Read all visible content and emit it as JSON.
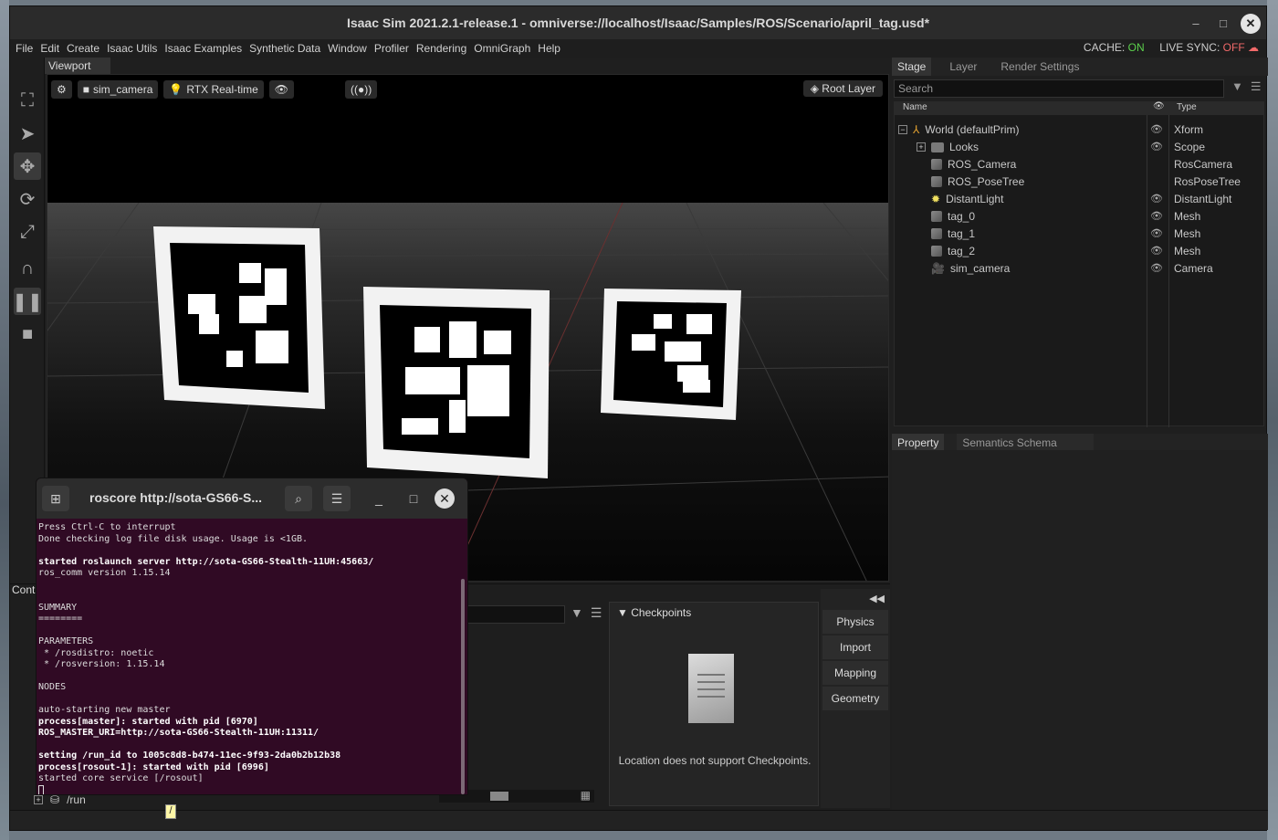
{
  "window": {
    "title": "Isaac Sim 2021.2.1-release.1 - omniverse://localhost/Isaac/Samples/ROS/Scenario/april_tag.usd*"
  },
  "menu": [
    "File",
    "Edit",
    "Create",
    "Isaac Utils",
    "Isaac Examples",
    "Synthetic Data",
    "Window",
    "Profiler",
    "Rendering",
    "OmniGraph",
    "Help"
  ],
  "status": {
    "cache_label": "CACHE:",
    "cache_value": "ON",
    "live_sync_label": "LIVE SYNC:",
    "live_sync_value": "OFF"
  },
  "viewport": {
    "tab": "Viewport",
    "camera": "sim_camera",
    "renderer": "RTX Real-time",
    "broadcast": "((●))",
    "root_layer": "Root Layer"
  },
  "stage": {
    "tabs": [
      "Stage",
      "Layer",
      "Render Settings"
    ],
    "search_placeholder": "Search",
    "col_name": "Name",
    "col_type": "Type",
    "rows": [
      {
        "name": "World (defaultPrim)",
        "type": "Xform",
        "visible": true
      },
      {
        "name": "Looks",
        "type": "Scope",
        "visible": true
      },
      {
        "name": "ROS_Camera",
        "type": "RosCamera",
        "visible": false
      },
      {
        "name": "ROS_PoseTree",
        "type": "RosPoseTree",
        "visible": false
      },
      {
        "name": "DistantLight",
        "type": "DistantLight",
        "visible": true
      },
      {
        "name": "tag_0",
        "type": "Mesh",
        "visible": true
      },
      {
        "name": "tag_1",
        "type": "Mesh",
        "visible": true
      },
      {
        "name": "tag_2",
        "type": "Mesh",
        "visible": true
      },
      {
        "name": "sim_camera",
        "type": "Camera",
        "visible": true
      }
    ]
  },
  "property": {
    "tabs": [
      "Property",
      "Semantics Schema Editor"
    ]
  },
  "bottom": {
    "content_tab": "Cont",
    "checkpoints_title": "Checkpoints",
    "checkpoints_msg": "Location does not support Checkpoints.",
    "side_buttons": [
      "Physics",
      "Import",
      "Mapping",
      "Geometry"
    ],
    "path": "/run",
    "tooltip": "/"
  },
  "terminal": {
    "title": "roscore http://sota-GS66-S...",
    "lines": [
      {
        "t": "Press Ctrl-C to interrupt",
        "b": false
      },
      {
        "t": "Done checking log file disk usage. Usage is <1GB.",
        "b": false
      },
      {
        "t": "",
        "b": false
      },
      {
        "t": "started roslaunch server http://sota-GS66-Stealth-11UH:45663/",
        "b": true
      },
      {
        "t": "ros_comm version 1.15.14",
        "b": false
      },
      {
        "t": "",
        "b": false
      },
      {
        "t": "",
        "b": false
      },
      {
        "t": "SUMMARY",
        "b": false
      },
      {
        "t": "========",
        "b": false
      },
      {
        "t": "",
        "b": false
      },
      {
        "t": "PARAMETERS",
        "b": false
      },
      {
        "t": " * /rosdistro: noetic",
        "b": false
      },
      {
        "t": " * /rosversion: 1.15.14",
        "b": false
      },
      {
        "t": "",
        "b": false
      },
      {
        "t": "NODES",
        "b": false
      },
      {
        "t": "",
        "b": false
      },
      {
        "t": "auto-starting new master",
        "b": false
      },
      {
        "t": "process[master]: started with pid [6970]",
        "b": true
      },
      {
        "t": "ROS_MASTER_URI=http://sota-GS66-Stealth-11UH:11311/",
        "b": true
      },
      {
        "t": "",
        "b": false
      },
      {
        "t": "setting /run_id to 1005c8d8-b474-11ec-9f93-2da0b2b12b38",
        "b": true
      },
      {
        "t": "process[rosout-1]: started with pid [6996]",
        "b": true
      },
      {
        "t": "started core service [/rosout]",
        "b": false
      }
    ]
  }
}
